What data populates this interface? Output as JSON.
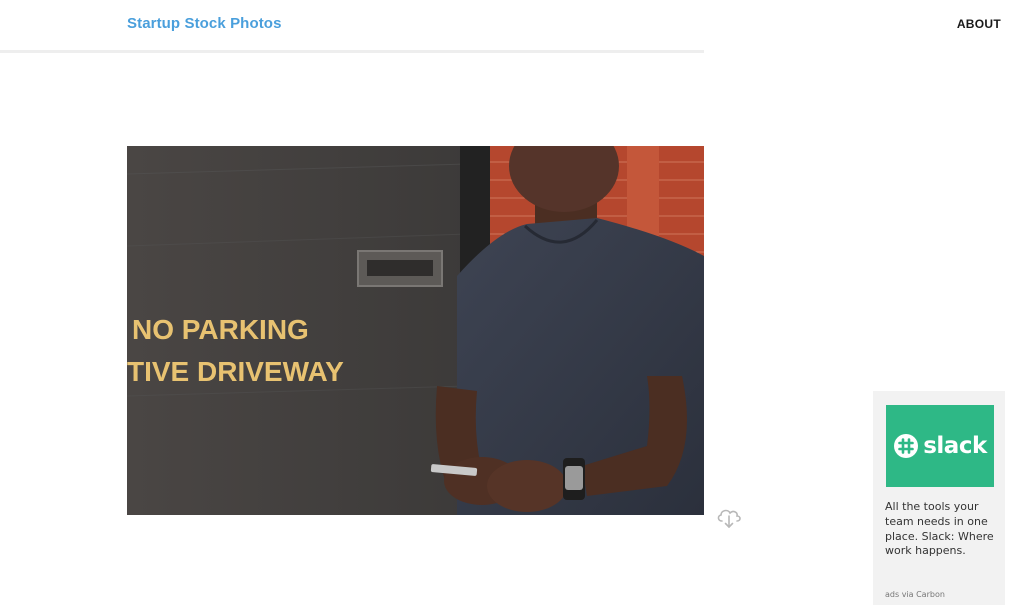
{
  "header": {
    "site_title": "Startup Stock Photos",
    "about_label": "ABOUT"
  },
  "photo": {
    "sign_line_1": "NO PARKING",
    "sign_line_2": "TIVE DRIVEWAY"
  },
  "download": {
    "icon": "cloud-download-icon"
  },
  "ad": {
    "brand": "slack",
    "text": "All the tools your team needs in one place. Slack: Where work happens.",
    "via": "ads via Carbon",
    "colors": {
      "brand_bg": "#2eb886"
    }
  },
  "colors": {
    "title": "#4a9fdc",
    "nav": "#1a1a1a"
  }
}
